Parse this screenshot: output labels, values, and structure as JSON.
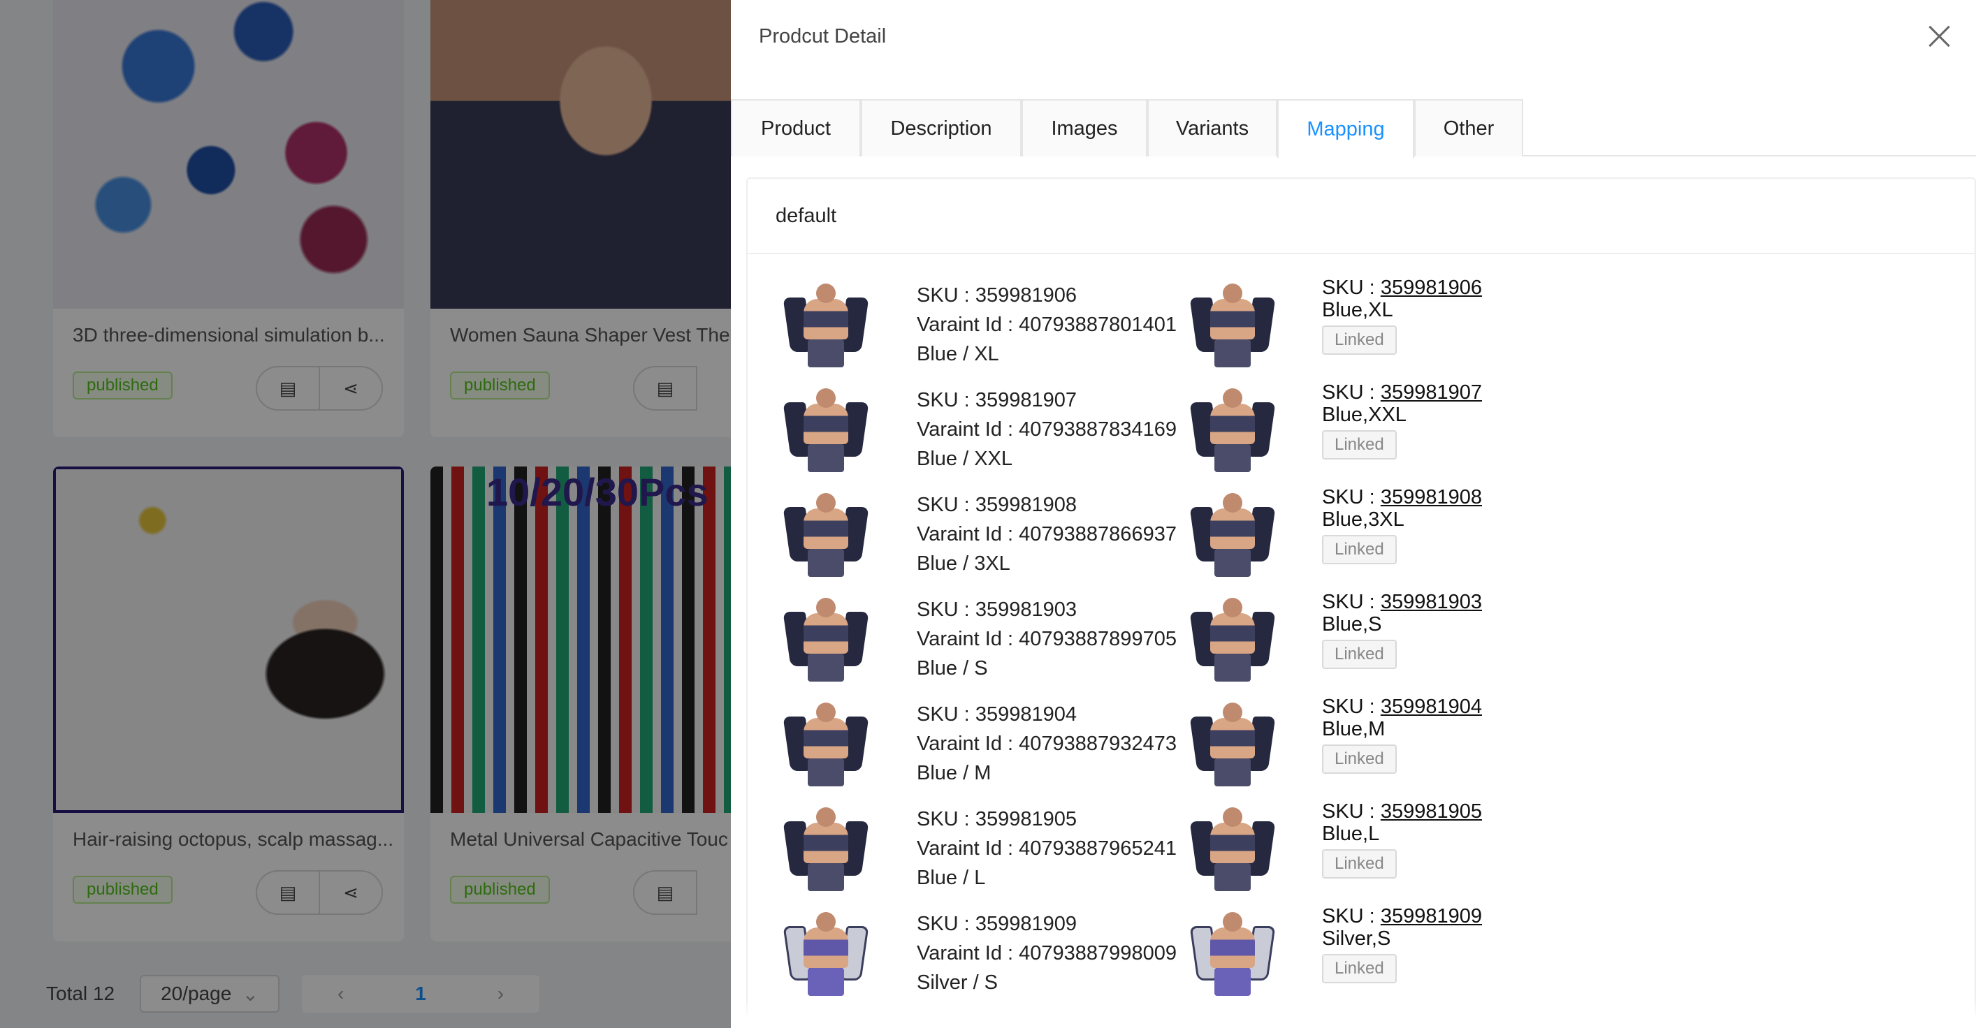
{
  "background": {
    "cards": [
      {
        "title": "3D three-dimensional simulation b...",
        "status": "published"
      },
      {
        "title": "Women Sauna Shaper Vest Ther",
        "status": "published"
      },
      {
        "title": "Hair-raising octopus, scalp massag...",
        "status": "published"
      },
      {
        "title": "Metal Universal Capacitive Touc",
        "status": "published"
      }
    ],
    "pens_banner": "10/20/30Pcs",
    "pagination": {
      "total": "Total 12",
      "page_size": "20/page",
      "current_page": "1",
      "prev": "‹",
      "next": "›",
      "caret": "⌄"
    }
  },
  "drawer": {
    "title": "Prodcut Detail",
    "tabs": [
      "Product",
      "Description",
      "Images",
      "Variants",
      "Mapping",
      "Other"
    ],
    "active_tab": "Mapping",
    "panel_title": "default",
    "sku_prefix": "SKU : ",
    "variant_prefix": "Varaint Id : ",
    "linked_label": "Linked",
    "mappings": [
      {
        "sku": "359981906",
        "variant_id": "40793887801401",
        "option": "Blue / XL",
        "target_sku": "359981906",
        "target_option": "Blue,XL",
        "status": "Linked"
      },
      {
        "sku": "359981907",
        "variant_id": "40793887834169",
        "option": "Blue / XXL",
        "target_sku": "359981907",
        "target_option": "Blue,XXL",
        "status": "Linked"
      },
      {
        "sku": "359981908",
        "variant_id": "40793887866937",
        "option": "Blue / 3XL",
        "target_sku": "359981908",
        "target_option": "Blue,3XL",
        "status": "Linked"
      },
      {
        "sku": "359981903",
        "variant_id": "40793887899705",
        "option": "Blue / S",
        "target_sku": "359981903",
        "target_option": "Blue,S",
        "status": "Linked"
      },
      {
        "sku": "359981904",
        "variant_id": "40793887932473",
        "option": "Blue / M",
        "target_sku": "359981904",
        "target_option": "Blue,M",
        "status": "Linked"
      },
      {
        "sku": "359981905",
        "variant_id": "40793887965241",
        "option": "Blue / L",
        "target_sku": "359981905",
        "target_option": "Blue,L",
        "status": "Linked"
      },
      {
        "sku": "359981909",
        "variant_id": "40793887998009",
        "option": "Silver / S",
        "target_sku": "359981909",
        "target_option": "Silver,S",
        "status": "Linked"
      }
    ]
  },
  "colors": {
    "accent": "#1890ff",
    "published_green": "#52c41a",
    "overlay": "rgba(0,0,0,0.45)"
  }
}
